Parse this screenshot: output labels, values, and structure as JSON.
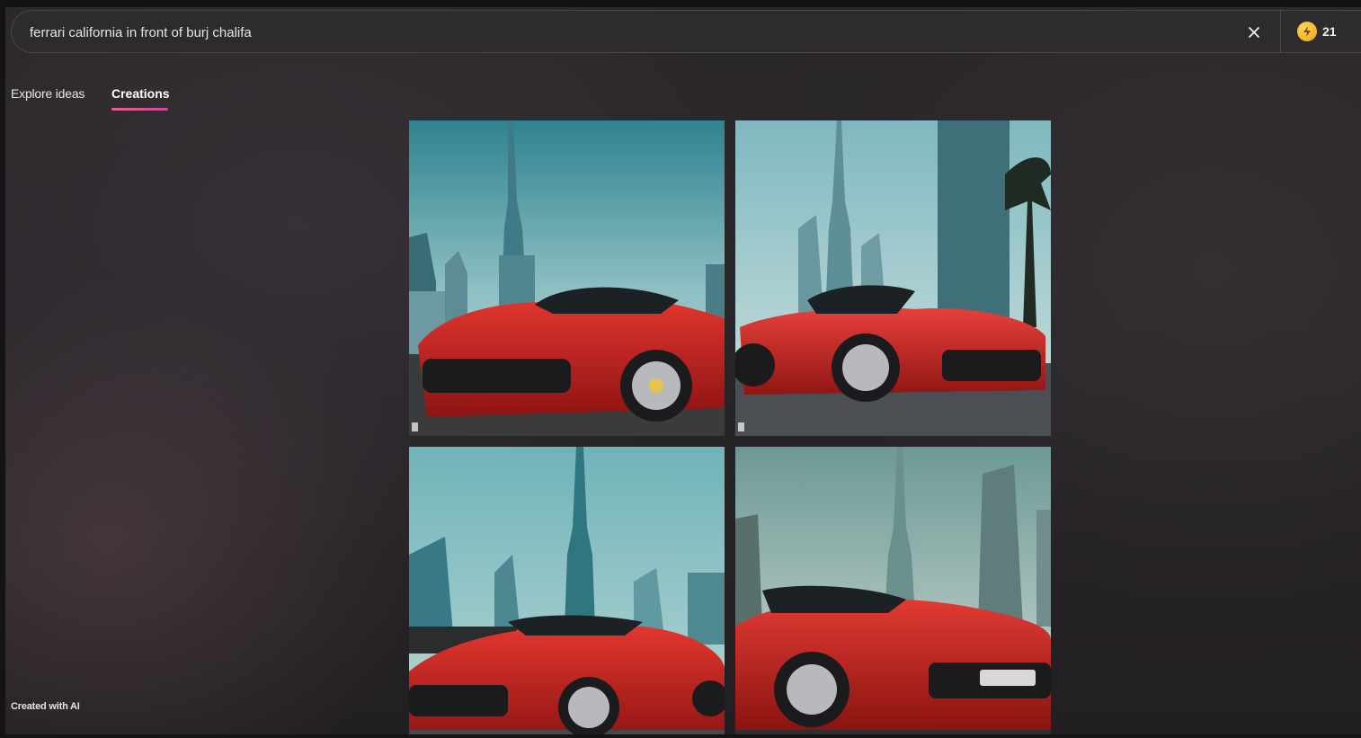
{
  "search": {
    "value": "ferrari california in front of burj chalifa"
  },
  "coins": {
    "count": "21"
  },
  "tabs": [
    {
      "label": "Explore ideas",
      "active": false
    },
    {
      "label": "Creations",
      "active": true
    }
  ],
  "colors": {
    "accent_underline": "#e8608a",
    "coin": "#f3b21b",
    "background": "#29262a"
  },
  "images": [
    {
      "name": "Red Ferrari California convertible in front of Burj Khalifa, front three-quarter view",
      "badge_icon": "bing-logo-icon"
    },
    {
      "name": "Red Ferrari California convertible with Burj Khalifa and palm tree, side view",
      "badge_icon": "bing-logo-icon"
    },
    {
      "name": "Red Ferrari California convertible in Dubai skyline, front view",
      "badge_icon": "none"
    },
    {
      "name": "Red Ferrari California convertible close-up with Burj Khalifa",
      "badge_icon": "none"
    }
  ],
  "footer": {
    "label": "Created with AI"
  }
}
